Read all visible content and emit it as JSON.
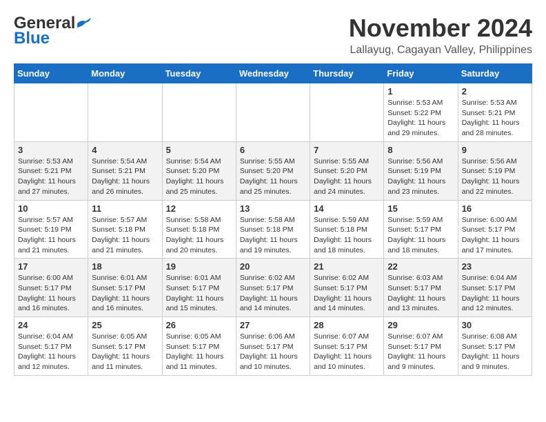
{
  "header": {
    "logo_general": "General",
    "logo_blue": "Blue",
    "month": "November 2024",
    "location": "Lallayug, Cagayan Valley, Philippines"
  },
  "weekdays": [
    "Sunday",
    "Monday",
    "Tuesday",
    "Wednesday",
    "Thursday",
    "Friday",
    "Saturday"
  ],
  "weeks": [
    [
      {
        "day": "",
        "info": ""
      },
      {
        "day": "",
        "info": ""
      },
      {
        "day": "",
        "info": ""
      },
      {
        "day": "",
        "info": ""
      },
      {
        "day": "",
        "info": ""
      },
      {
        "day": "1",
        "info": "Sunrise: 5:53 AM\nSunset: 5:22 PM\nDaylight: 11 hours and 29 minutes."
      },
      {
        "day": "2",
        "info": "Sunrise: 5:53 AM\nSunset: 5:21 PM\nDaylight: 11 hours and 28 minutes."
      }
    ],
    [
      {
        "day": "3",
        "info": "Sunrise: 5:53 AM\nSunset: 5:21 PM\nDaylight: 11 hours and 27 minutes."
      },
      {
        "day": "4",
        "info": "Sunrise: 5:54 AM\nSunset: 5:21 PM\nDaylight: 11 hours and 26 minutes."
      },
      {
        "day": "5",
        "info": "Sunrise: 5:54 AM\nSunset: 5:20 PM\nDaylight: 11 hours and 25 minutes."
      },
      {
        "day": "6",
        "info": "Sunrise: 5:55 AM\nSunset: 5:20 PM\nDaylight: 11 hours and 25 minutes."
      },
      {
        "day": "7",
        "info": "Sunrise: 5:55 AM\nSunset: 5:20 PM\nDaylight: 11 hours and 24 minutes."
      },
      {
        "day": "8",
        "info": "Sunrise: 5:56 AM\nSunset: 5:19 PM\nDaylight: 11 hours and 23 minutes."
      },
      {
        "day": "9",
        "info": "Sunrise: 5:56 AM\nSunset: 5:19 PM\nDaylight: 11 hours and 22 minutes."
      }
    ],
    [
      {
        "day": "10",
        "info": "Sunrise: 5:57 AM\nSunset: 5:19 PM\nDaylight: 11 hours and 21 minutes."
      },
      {
        "day": "11",
        "info": "Sunrise: 5:57 AM\nSunset: 5:18 PM\nDaylight: 11 hours and 21 minutes."
      },
      {
        "day": "12",
        "info": "Sunrise: 5:58 AM\nSunset: 5:18 PM\nDaylight: 11 hours and 20 minutes."
      },
      {
        "day": "13",
        "info": "Sunrise: 5:58 AM\nSunset: 5:18 PM\nDaylight: 11 hours and 19 minutes."
      },
      {
        "day": "14",
        "info": "Sunrise: 5:59 AM\nSunset: 5:18 PM\nDaylight: 11 hours and 18 minutes."
      },
      {
        "day": "15",
        "info": "Sunrise: 5:59 AM\nSunset: 5:17 PM\nDaylight: 11 hours and 18 minutes."
      },
      {
        "day": "16",
        "info": "Sunrise: 6:00 AM\nSunset: 5:17 PM\nDaylight: 11 hours and 17 minutes."
      }
    ],
    [
      {
        "day": "17",
        "info": "Sunrise: 6:00 AM\nSunset: 5:17 PM\nDaylight: 11 hours and 16 minutes."
      },
      {
        "day": "18",
        "info": "Sunrise: 6:01 AM\nSunset: 5:17 PM\nDaylight: 11 hours and 16 minutes."
      },
      {
        "day": "19",
        "info": "Sunrise: 6:01 AM\nSunset: 5:17 PM\nDaylight: 11 hours and 15 minutes."
      },
      {
        "day": "20",
        "info": "Sunrise: 6:02 AM\nSunset: 5:17 PM\nDaylight: 11 hours and 14 minutes."
      },
      {
        "day": "21",
        "info": "Sunrise: 6:02 AM\nSunset: 5:17 PM\nDaylight: 11 hours and 14 minutes."
      },
      {
        "day": "22",
        "info": "Sunrise: 6:03 AM\nSunset: 5:17 PM\nDaylight: 11 hours and 13 minutes."
      },
      {
        "day": "23",
        "info": "Sunrise: 6:04 AM\nSunset: 5:17 PM\nDaylight: 11 hours and 12 minutes."
      }
    ],
    [
      {
        "day": "24",
        "info": "Sunrise: 6:04 AM\nSunset: 5:17 PM\nDaylight: 11 hours and 12 minutes."
      },
      {
        "day": "25",
        "info": "Sunrise: 6:05 AM\nSunset: 5:17 PM\nDaylight: 11 hours and 11 minutes."
      },
      {
        "day": "26",
        "info": "Sunrise: 6:05 AM\nSunset: 5:17 PM\nDaylight: 11 hours and 11 minutes."
      },
      {
        "day": "27",
        "info": "Sunrise: 6:06 AM\nSunset: 5:17 PM\nDaylight: 11 hours and 10 minutes."
      },
      {
        "day": "28",
        "info": "Sunrise: 6:07 AM\nSunset: 5:17 PM\nDaylight: 11 hours and 10 minutes."
      },
      {
        "day": "29",
        "info": "Sunrise: 6:07 AM\nSunset: 5:17 PM\nDaylight: 11 hours and 9 minutes."
      },
      {
        "day": "30",
        "info": "Sunrise: 6:08 AM\nSunset: 5:17 PM\nDaylight: 11 hours and 9 minutes."
      }
    ]
  ]
}
